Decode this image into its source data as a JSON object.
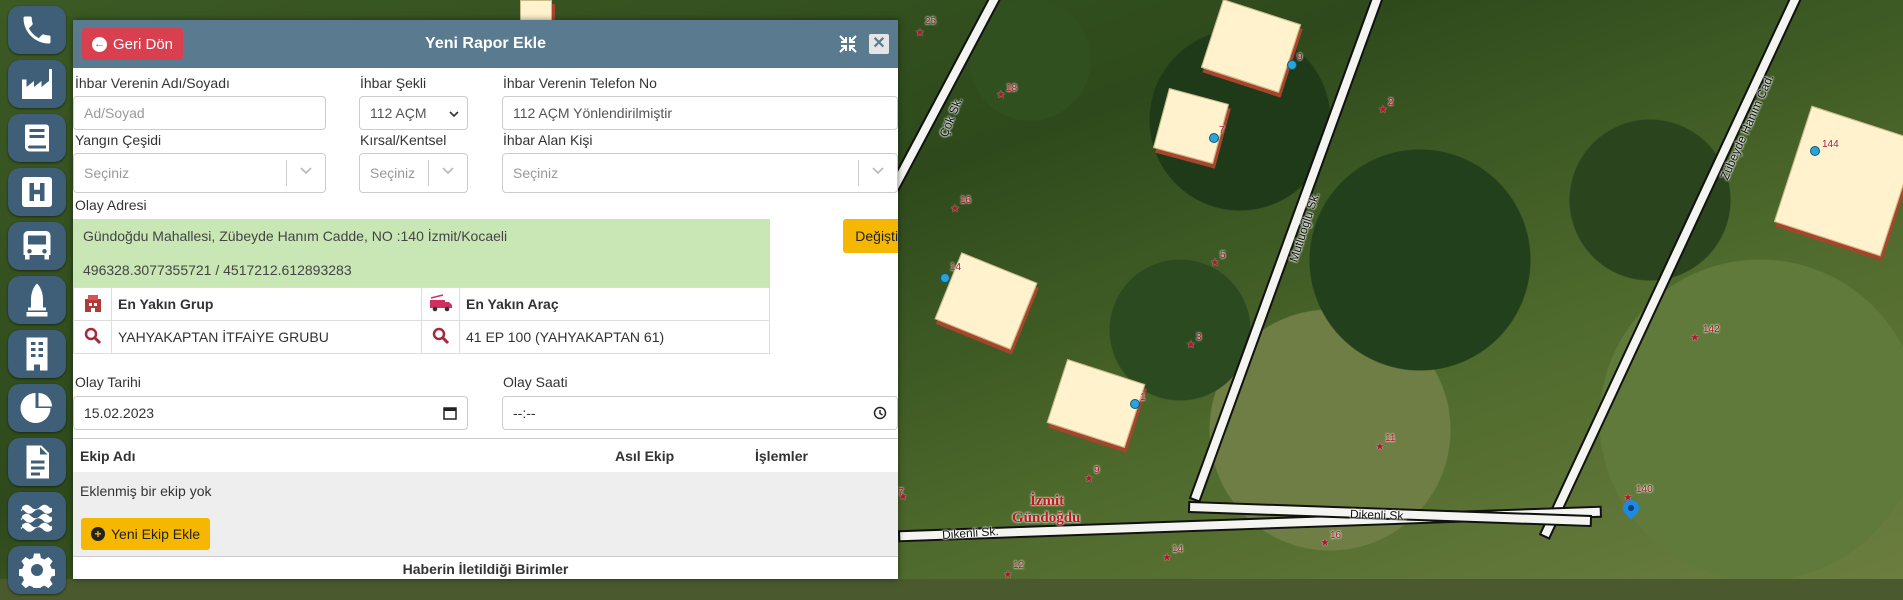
{
  "toolbar": {
    "items": [
      {
        "icon": "phone-icon"
      },
      {
        "icon": "factory-icon"
      },
      {
        "icon": "book-icon"
      },
      {
        "icon": "hospital-icon"
      },
      {
        "icon": "bus-icon"
      },
      {
        "icon": "rocket-icon"
      },
      {
        "icon": "building-icon"
      },
      {
        "icon": "pie-chart-icon"
      },
      {
        "icon": "document-icon"
      },
      {
        "icon": "water-icon"
      },
      {
        "icon": "gear-icon"
      }
    ]
  },
  "panel": {
    "back_label": "Geri Dön",
    "title": "Yeni Rapor Ekle",
    "colors": {
      "header": "#5a7a90",
      "back": "#d9404f",
      "accent": "#f5b700",
      "address_bg": "#c9e6b5"
    }
  },
  "form": {
    "reporter_name": {
      "label": "İhbar Verenin Adı/Soyadı",
      "placeholder": "Ad/Soyad"
    },
    "report_type": {
      "label": "İhbar Şekli",
      "value": "112 AÇM"
    },
    "reporter_phone": {
      "label": "İhbar Verenin Telefon No",
      "value": "112 AÇM Yönlendirilmiştir"
    },
    "fire_type": {
      "label": "Yangın Çeşidi",
      "placeholder": "Seçiniz"
    },
    "rural_urban": {
      "label": "Kırsal/Kentsel",
      "placeholder": "Seçiniz"
    },
    "receiver": {
      "label": "İhbar Alan Kişi",
      "placeholder": "Seçiniz"
    },
    "address": {
      "label": "Olay Adresi",
      "text": "Gündoğdu Mahallesi, Zübeyde Hanım Cadde, NO :140 İzmit/Kocaeli",
      "coords": "496328.3077355721 / 4517212.612893283",
      "change_label": "Değiştir"
    },
    "nearest": {
      "group_header": "En Yakın Grup",
      "vehicle_header": "En Yakın Araç",
      "group_value": "YAHYAKAPTAN İTFAİYE GRUBU",
      "vehicle_value": "41 EP 100 (YAHYAKAPTAN 61)"
    },
    "event_date": {
      "label": "Olay Tarihi",
      "value": "15.02.2023"
    },
    "event_time": {
      "label": "Olay Saati",
      "value": "--:--"
    }
  },
  "teams": {
    "col_name": "Ekip Adı",
    "col_main": "Asıl Ekip",
    "col_actions": "İşlemler",
    "empty_text": "Eklenmiş bir ekip yok",
    "add_label": "Yeni Ekip Ekle"
  },
  "units_title": "Haberin İletildiği Birimler",
  "map": {
    "streets": [
      "Çök Sk.",
      "Mutluoğlu Sk.",
      "Zübeyde Hanım Cad.",
      "Dikenli Sk.",
      "Dikenli Sk."
    ],
    "place": [
      "İzmit",
      "Gündoğdu"
    ],
    "pins": [
      "25",
      "18",
      "2",
      "16",
      "5",
      "3",
      "11",
      "9",
      "16",
      "14",
      "12",
      "7",
      "142",
      "140"
    ],
    "house_numbers": [
      "9",
      "7",
      "144",
      "14",
      "1"
    ]
  }
}
